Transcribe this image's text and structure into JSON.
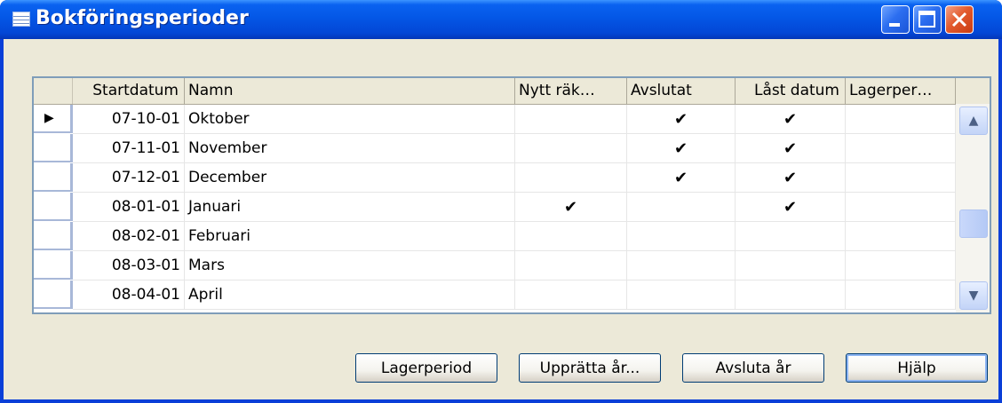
{
  "window": {
    "title": "Bokföringsperioder"
  },
  "colors": {
    "titlebar": "#0457e6",
    "client": "#ece9d8",
    "grid_border": "#7f9db9",
    "close_button": "#e35b2e"
  },
  "table": {
    "columns": [
      "Startdatum",
      "Namn",
      "Nytt räk…",
      "Avslutat",
      "Låst datum",
      "Lagerper…"
    ],
    "rows": [
      {
        "current": true,
        "start": "07-10-01",
        "name": "Oktober",
        "new_year": "",
        "closed": "✔",
        "locked": "✔",
        "inv": ""
      },
      {
        "current": false,
        "start": "07-11-01",
        "name": "November",
        "new_year": "",
        "closed": "✔",
        "locked": "✔",
        "inv": ""
      },
      {
        "current": false,
        "start": "07-12-01",
        "name": "December",
        "new_year": "",
        "closed": "✔",
        "locked": "✔",
        "inv": ""
      },
      {
        "current": false,
        "start": "08-01-01",
        "name": "Januari",
        "new_year": "✔",
        "closed": "",
        "locked": "✔",
        "inv": ""
      },
      {
        "current": false,
        "start": "08-02-01",
        "name": "Februari",
        "new_year": "",
        "closed": "",
        "locked": "",
        "inv": ""
      },
      {
        "current": false,
        "start": "08-03-01",
        "name": "Mars",
        "new_year": "",
        "closed": "",
        "locked": "",
        "inv": ""
      },
      {
        "current": false,
        "start": "08-04-01",
        "name": "April",
        "new_year": "",
        "closed": "",
        "locked": "",
        "inv": ""
      }
    ],
    "current_row_marker": "▶"
  },
  "scrollbar": {
    "up_glyph": "▲",
    "down_glyph": "▼"
  },
  "buttons": {
    "lagerperiod": "Lagerperiod",
    "uppratta": "Upprätta år...",
    "avsluta": "Avsluta år",
    "hjalp": "Hjälp"
  },
  "icons": {
    "title": "table-icon",
    "minimize": "minimize-icon",
    "maximize": "maximize-icon",
    "close": "close-icon",
    "row_marker": "play-icon"
  }
}
